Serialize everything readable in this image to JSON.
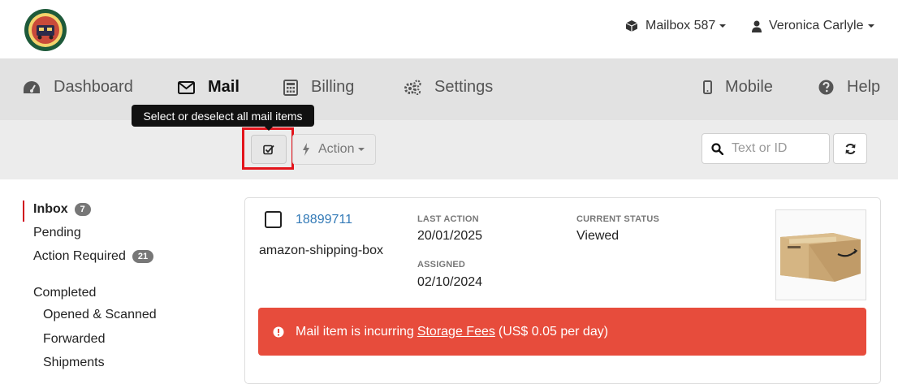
{
  "header": {
    "mailbox_label": "Mailbox 587",
    "user_label": "Veronica Carlyle"
  },
  "nav": {
    "items": [
      {
        "label": "Dashboard",
        "icon": "dashboard-icon"
      },
      {
        "label": "Mail",
        "icon": "envelope-icon",
        "active": true
      },
      {
        "label": "Billing",
        "icon": "calculator-icon"
      },
      {
        "label": "Settings",
        "icon": "gears-icon"
      },
      {
        "label": "Mobile",
        "icon": "mobile-icon"
      },
      {
        "label": "Help",
        "icon": "help-icon"
      }
    ]
  },
  "toolbar": {
    "tooltip": "Select or deselect all mail items",
    "action_label": "Action",
    "search_placeholder": "Text or ID"
  },
  "sidebar": {
    "items": [
      {
        "label": "Inbox",
        "badge": "7",
        "active": true
      },
      {
        "label": "Pending"
      },
      {
        "label": "Action Required",
        "badge": "21"
      },
      {
        "label": "Completed"
      },
      {
        "label": "Opened & Scanned"
      },
      {
        "label": "Forwarded"
      },
      {
        "label": "Shipments"
      }
    ]
  },
  "mail_item": {
    "id": "18899711",
    "name": "amazon-shipping-box",
    "last_action_label": "LAST ACTION",
    "last_action_value": "20/01/2025",
    "assigned_label": "ASSIGNED",
    "assigned_value": "02/10/2024",
    "status_label": "CURRENT STATUS",
    "status_value": "Viewed",
    "alert": {
      "prefix": "Mail item is incurring",
      "link": "Storage Fees",
      "suffix": "(US$ 0.05 per day)"
    }
  },
  "colors": {
    "accent_red": "#d0021b",
    "alert_red": "#e74c3c",
    "link_blue": "#337ab7",
    "nav_bg": "#e2e2e2"
  }
}
